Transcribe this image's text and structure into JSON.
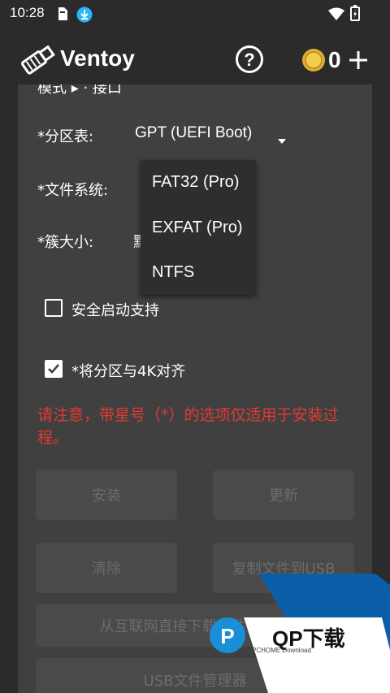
{
  "status_bar": {
    "time": "10:28"
  },
  "app_bar": {
    "title": "Ventoy",
    "coin_count": "0"
  },
  "panel": {
    "top_label_partial": "模式 ▸ · 接口",
    "partition_label": "*分区表:",
    "partition_value": "GPT (UEFI Boot)",
    "filesystem_label": "*文件系统:",
    "cluster_label": "*簇大小:",
    "cluster_value_partial": "默",
    "secure_boot_label": "安全启动支持",
    "align_label": "*将分区与4K对齐",
    "warning": "请注意，带星号（*）的选项仅适用于安装过程。",
    "buttons": {
      "install": "安装",
      "update": "更新",
      "clear": "清除",
      "copy": "复制文件到USB",
      "download": "从互联网直接下载文件到USB",
      "usb_manager": "USB文件管理器"
    }
  },
  "dropdown": {
    "options": [
      "FAT32 (Pro)",
      "EXFAT (Pro)",
      "NTFS"
    ]
  },
  "watermark": {
    "text": "QP下载",
    "sub": "PCHOME  Download"
  },
  "colors": {
    "warning": "#e53935",
    "background": "#2b2b2b",
    "panel": "#404040",
    "watermark": "#0a5fa8"
  }
}
